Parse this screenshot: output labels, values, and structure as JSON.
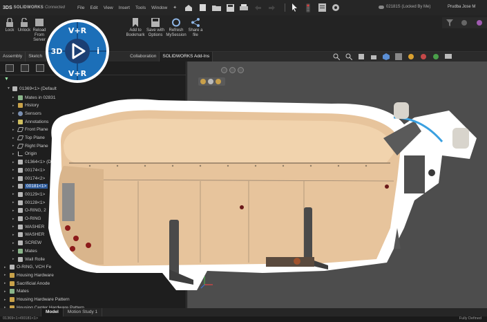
{
  "titlebar": {
    "brand_prefix": "3DS",
    "brand": "SOLIDWORKS",
    "brand_sub": "Connected",
    "menus": [
      "File",
      "Edit",
      "View",
      "Insert",
      "Tools",
      "Window"
    ],
    "document_status": "02181S (Locked By Me)",
    "user": "Prudba Jose M"
  },
  "ribbon": {
    "buttons": [
      {
        "label": "Lock"
      },
      {
        "label": "Unlock"
      },
      {
        "label": "Reload From Server"
      },
      {
        "label": "Add to Bookmark"
      },
      {
        "label": "Save with Options"
      },
      {
        "label": "Refresh MySession"
      },
      {
        "label": "Share a file"
      }
    ]
  },
  "tabs": [
    {
      "label": "Assembly"
    },
    {
      "label": "Sketch"
    },
    {
      "label": "Collaboration"
    },
    {
      "label": "SOLIDWORKS Add-Ins"
    }
  ],
  "tree": {
    "root": "01369<1> (Default",
    "items": [
      {
        "label": "Mates in 02831",
        "icon": "mate"
      },
      {
        "label": "History",
        "icon": "folder"
      },
      {
        "label": "Sensors",
        "icon": "sensor"
      },
      {
        "label": "Annotations",
        "icon": "annot"
      },
      {
        "label": "Front Plane",
        "icon": "plane"
      },
      {
        "label": "Top Plane",
        "icon": "plane"
      },
      {
        "label": "Right Plane",
        "icon": "plane"
      },
      {
        "label": "Origin",
        "icon": "origin"
      },
      {
        "label": "01364<1> (De",
        "icon": "part"
      },
      {
        "label": "00174<1>",
        "icon": "part"
      },
      {
        "label": "00174<2>",
        "icon": "part"
      },
      {
        "label": "00181<1>",
        "icon": "part",
        "selected": true
      },
      {
        "label": "00129<1>",
        "icon": "part"
      },
      {
        "label": "00128<1>",
        "icon": "part"
      },
      {
        "label": "O-RING, 2",
        "icon": "part"
      },
      {
        "label": "O-RING",
        "icon": "part"
      },
      {
        "label": "WASHER",
        "icon": "part"
      },
      {
        "label": "WASHER",
        "icon": "part"
      },
      {
        "label": "SCREW",
        "icon": "part"
      },
      {
        "label": "Mates",
        "icon": "mate"
      },
      {
        "label": "Wall Rolle",
        "icon": "part"
      },
      {
        "label": "O-RING, VCH Fe",
        "icon": "part"
      },
      {
        "label": "Housing Hardware",
        "icon": "folder"
      },
      {
        "label": "Sacrificial Anode",
        "icon": "folder"
      },
      {
        "label": "Mates",
        "icon": "mate"
      },
      {
        "label": "Housing Hardware Pattern",
        "icon": "folder"
      },
      {
        "label": "Housing Center Hardware Pattern",
        "icon": "folder"
      }
    ]
  },
  "bottom_tabs": [
    {
      "label": "Model",
      "active": true
    },
    {
      "label": "Motion Study 1",
      "active": false
    }
  ],
  "status": {
    "left": "01369<1>/00181<1>",
    "right": "Fully Defined"
  },
  "logo": {
    "top": "V+R",
    "left": "3D",
    "right": "i",
    "bottom": "V+R",
    "ring_color": "#1c6fb8",
    "center_color": "#1b3f73"
  },
  "colors": {
    "selection": "#2d5a9a",
    "model_body": "#e6c39a",
    "outline": "#ffffff"
  }
}
